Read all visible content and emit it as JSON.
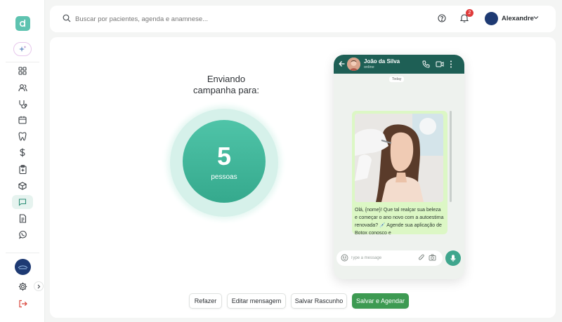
{
  "app": {
    "logo_icon": "app-logo-icon",
    "accent": "#5ec3b0"
  },
  "sidebar": {
    "items": [
      {
        "name": "dashboard",
        "icon": "grid-icon"
      },
      {
        "name": "patients",
        "icon": "users-icon"
      },
      {
        "name": "stethoscope",
        "icon": "stethoscope-icon"
      },
      {
        "name": "calendar",
        "icon": "calendar-icon"
      },
      {
        "name": "dental",
        "icon": "tooth-icon"
      },
      {
        "name": "finance",
        "icon": "dollar-icon"
      },
      {
        "name": "clipboard",
        "icon": "clipboard-icon"
      },
      {
        "name": "inventory",
        "icon": "box-icon"
      },
      {
        "name": "messages",
        "icon": "chat-icon",
        "active": true
      },
      {
        "name": "documents",
        "icon": "document-icon"
      },
      {
        "name": "whatsapp",
        "icon": "whatsapp-icon"
      }
    ]
  },
  "header": {
    "search_placeholder": "Buscar por pacientes, agenda e anamnese...",
    "notifications_count": "2",
    "user_name": "Alexandre"
  },
  "campaign": {
    "title": "Enviando\ncampanha para:",
    "count": "5",
    "count_unit": "pessoas"
  },
  "phone": {
    "contact_name": "João da Silva",
    "contact_status": "online",
    "date_label": "Today",
    "message_text": "Olá, {nome}! Que tal realçar sua beleza e começar o ano novo com a autoestima renovada? 💉 Agende sua aplicação de Botox conosco e",
    "input_placeholder": "Type a message"
  },
  "actions": {
    "redo": "Refazer",
    "edit": "Editar mensagem",
    "save_draft": "Salvar Rascunho",
    "save_schedule": "Salvar e Agendar"
  },
  "colors": {
    "whatsapp_header": "#1e5f55",
    "bubble": "#dcf7c5",
    "primary_button": "#3d9a52",
    "badge": "#e03b3b"
  }
}
